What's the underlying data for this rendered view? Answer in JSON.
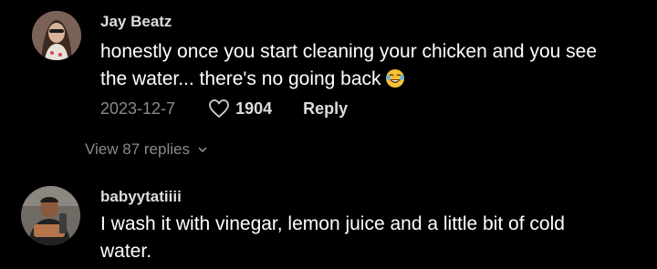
{
  "comments": [
    {
      "username": "Jay Beatz",
      "text_line1": "honestly once you start cleaning your chicken and you see",
      "text_line2": "the water... there's no going back",
      "emoji": "laughing-emoji",
      "date": "2023-12-7",
      "likes": "1904",
      "reply_label": "Reply",
      "view_replies_label": "View 87 replies"
    },
    {
      "username": "babyytatiiii",
      "text_line1": "I wash it with vinegar, lemon juice and a little bit of cold",
      "text_line2": "water."
    }
  ],
  "colors": {
    "background": "#000000",
    "primary_text": "#ffffff",
    "secondary_text": "#8a8a8a",
    "emoji_yellow": "#f6c235"
  },
  "icons": [
    "heart-outline-icon",
    "chevron-down-icon",
    "laughing-emoji"
  ]
}
